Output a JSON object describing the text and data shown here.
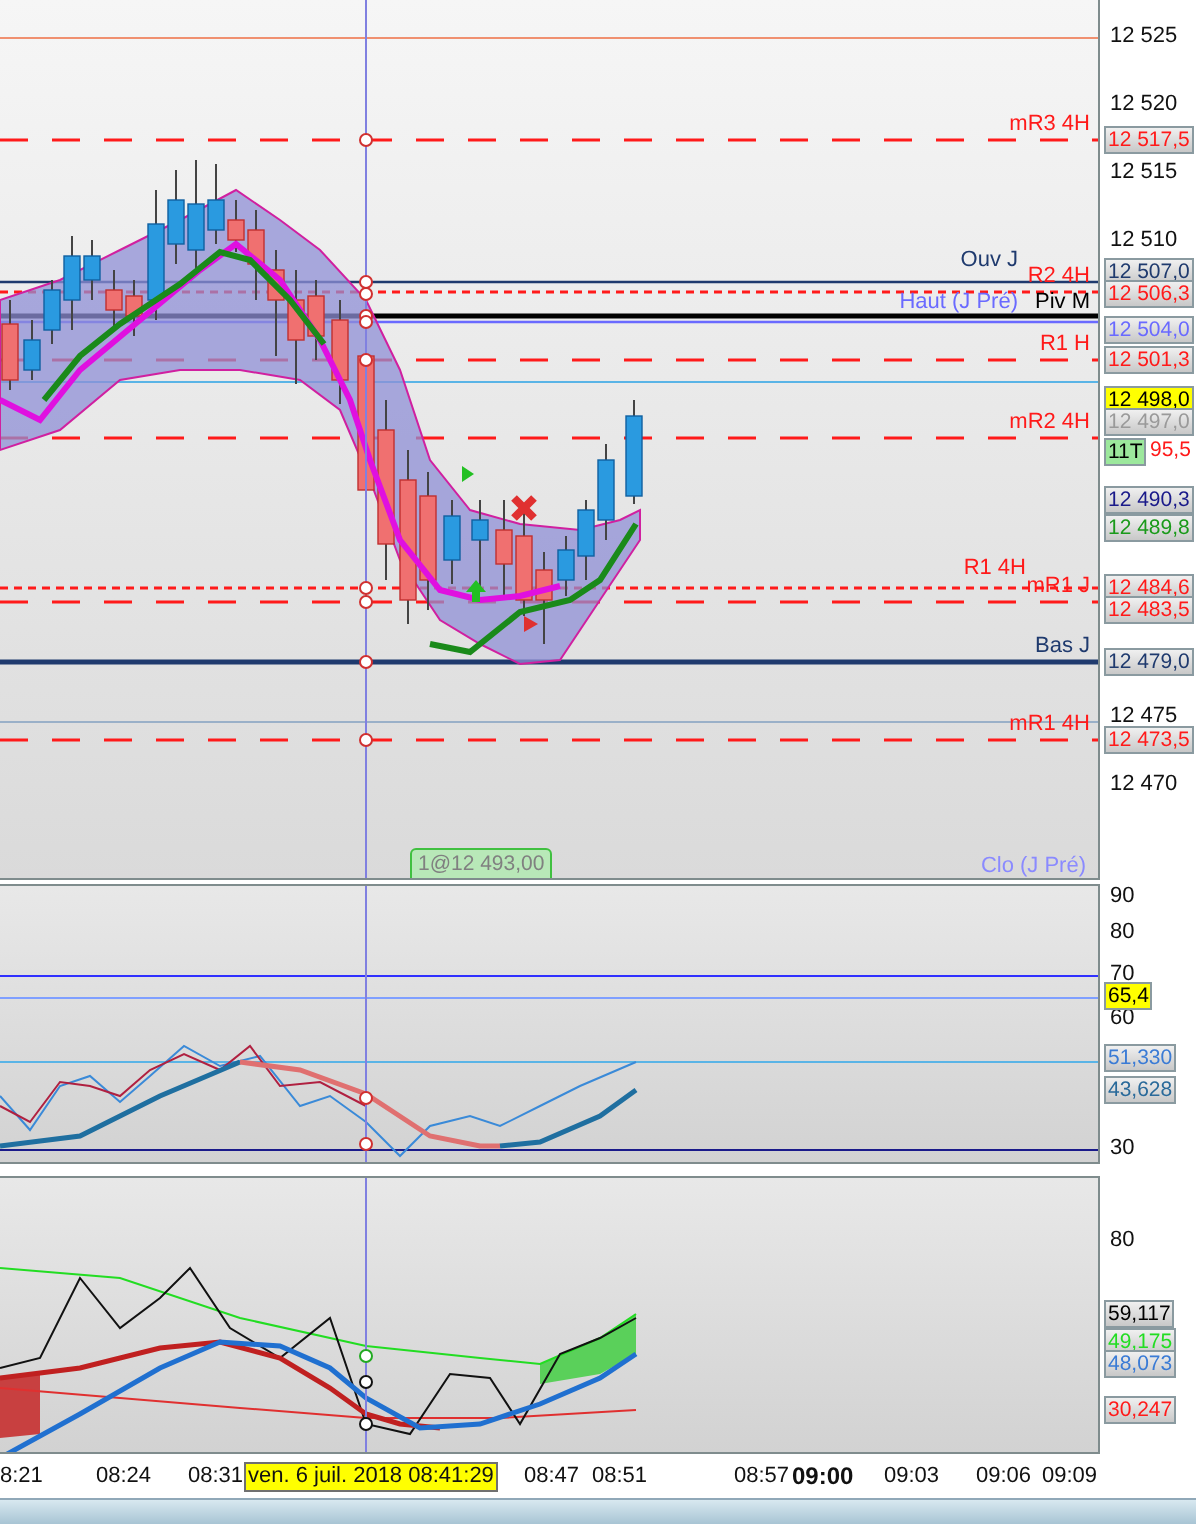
{
  "main_chart": {
    "price_ticks": [
      {
        "label": "12 525"
      },
      {
        "label": "12 520"
      },
      {
        "label": "12 515"
      },
      {
        "label": "12 510"
      },
      {
        "label": "12 475"
      },
      {
        "label": "12 470"
      }
    ],
    "levels": [
      {
        "label": "mR3 4H",
        "color": "#ff1a1a",
        "kind": "dashed"
      },
      {
        "label": "Ouv J",
        "color": "#1f3a6e",
        "kind": "solid"
      },
      {
        "label": "R2 4H",
        "color": "#ff1a1a",
        "kind": "dotted"
      },
      {
        "label": "Haut (J Pré)",
        "color": "#6a6aff",
        "kind": "solid"
      },
      {
        "label": "Piv M",
        "color": "#000000",
        "kind": "thick"
      },
      {
        "label": "R1 H",
        "color": "#ff1a1a",
        "kind": "dashed"
      },
      {
        "label": "mR2 4H",
        "color": "#ff1a1a",
        "kind": "dashed"
      },
      {
        "label": "R1 4H",
        "color": "#ff1a1a",
        "kind": "dotted"
      },
      {
        "label": "mR1 J",
        "color": "#ff1a1a",
        "kind": "dashed"
      },
      {
        "label": "Bas J",
        "color": "#1f3a6e",
        "kind": "thick"
      },
      {
        "label": "mR1 4H",
        "color": "#ff1a1a",
        "kind": "dashed"
      },
      {
        "label": "Clo (J Pré)",
        "color": "#8a8aff",
        "kind": "text_only"
      }
    ],
    "price_tags": [
      {
        "text": "12 517,5",
        "color": "#ff1a1a",
        "kind": "grey"
      },
      {
        "text": "12 507,0",
        "color": "#1f3a6e",
        "kind": "grey"
      },
      {
        "text": "12 506,3",
        "color": "#ff1a1a",
        "kind": "grey"
      },
      {
        "text": "12 504,0",
        "color": "#6a6aff",
        "kind": "grey"
      },
      {
        "text": "12 501,3",
        "color": "#ff1a1a",
        "kind": "grey"
      },
      {
        "text": "12 498,0",
        "kind": "yellow"
      },
      {
        "text": "12 497,0",
        "color": "#9a9a9a",
        "kind": "grey"
      },
      {
        "text": "11T",
        "kind": "green"
      },
      {
        "text": "95,5",
        "color": "#ff1a1a",
        "kind": "bare"
      },
      {
        "text": "12 490,3",
        "color": "#1a1a8a",
        "kind": "grey"
      },
      {
        "text": "12 489,8",
        "color": "#1a9a1a",
        "kind": "grey"
      },
      {
        "text": "12 484,6",
        "color": "#ff1a1a",
        "kind": "grey"
      },
      {
        "text": "12 483,5",
        "color": "#ff1a1a",
        "kind": "grey"
      },
      {
        "text": "12 479,0",
        "color": "#1f3a6e",
        "kind": "grey"
      },
      {
        "text": "12 473,5",
        "color": "#ff1a1a",
        "kind": "grey"
      }
    ],
    "order_badge": "1@12 493,00"
  },
  "oscillator_1": {
    "ticks": [
      {
        "label": "90"
      },
      {
        "label": "80"
      },
      {
        "label": "70"
      },
      {
        "label": "60"
      },
      {
        "label": "30"
      }
    ],
    "tags": [
      {
        "text": "65,4",
        "kind": "yellow"
      },
      {
        "text": "51,330",
        "color": "#3a7bd5",
        "kind": "grey"
      },
      {
        "text": "43,628",
        "color": "#2a6a9a",
        "kind": "grey"
      }
    ]
  },
  "oscillator_2": {
    "ticks": [
      {
        "label": "80"
      }
    ],
    "tags": [
      {
        "text": "59,117",
        "color": "#000000",
        "kind": "grey"
      },
      {
        "text": "49,175",
        "color": "#22dd22",
        "kind": "grey"
      },
      {
        "text": "48,073",
        "color": "#3a7bd5",
        "kind": "grey"
      },
      {
        "text": "30,247",
        "color": "#ff1a1a",
        "kind": "grey"
      }
    ]
  },
  "time_axis": [
    {
      "label": "8:21",
      "kind": "normal"
    },
    {
      "label": "08:24",
      "kind": "normal"
    },
    {
      "label": "08:31",
      "kind": "normal"
    },
    {
      "label": "ven. 6 juil. 2018 08:41:29",
      "kind": "cursor"
    },
    {
      "label": "08:47",
      "kind": "normal"
    },
    {
      "label": "08:51",
      "kind": "normal"
    },
    {
      "label": "08:57",
      "kind": "normal"
    },
    {
      "label": "09:00",
      "kind": "bold"
    },
    {
      "label": "09:03",
      "kind": "normal"
    },
    {
      "label": "09:06",
      "kind": "normal"
    },
    {
      "label": "09:09",
      "kind": "normal"
    }
  ]
}
